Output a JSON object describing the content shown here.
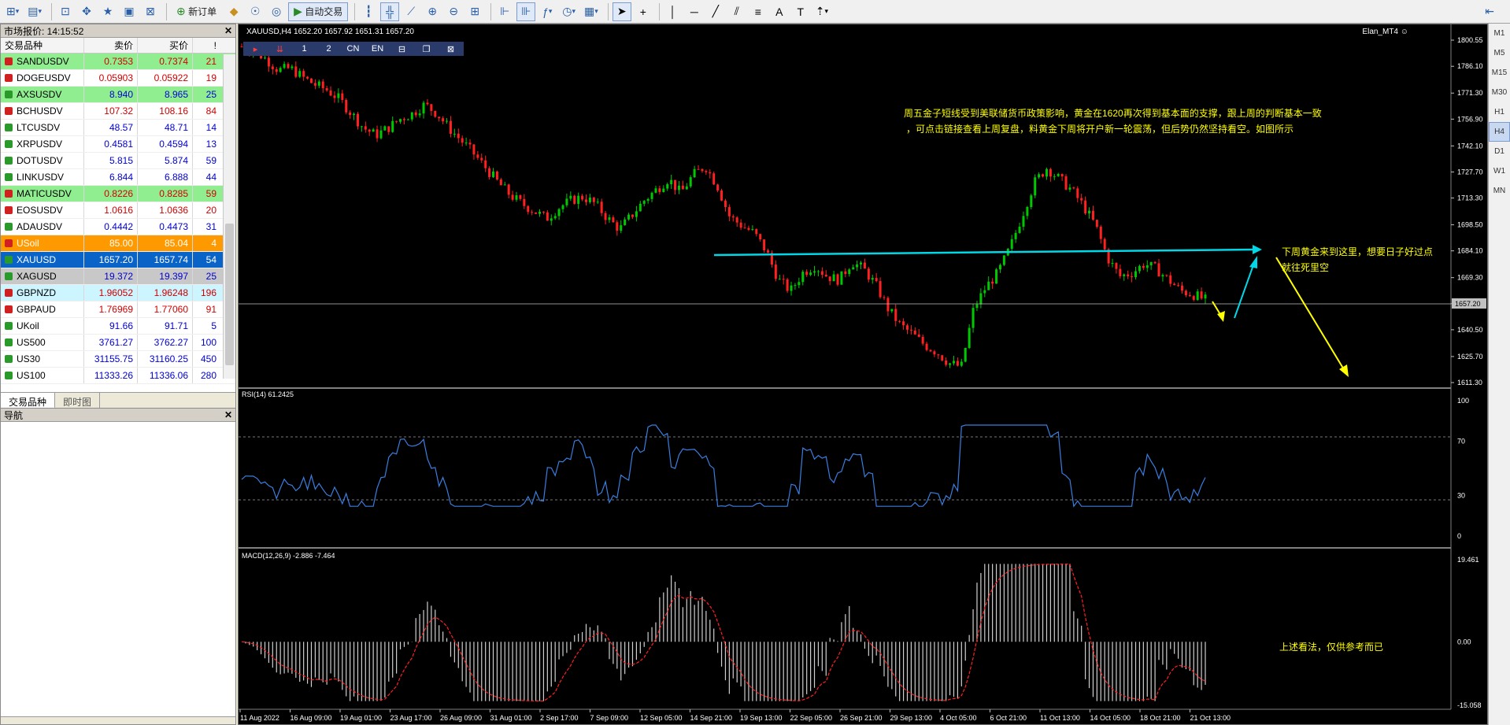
{
  "toolbar": {
    "new_order": "新订单",
    "auto_trade": "自动交易"
  },
  "market": {
    "title": "市场报价: 14:15:52",
    "headers": {
      "symbol": "交易品种",
      "bid": "卖价",
      "ask": "买价",
      "spread": "!"
    },
    "rows": [
      {
        "symbol": "SANDUSDV",
        "bid": "0.7353",
        "ask": "0.7374",
        "spread": "21",
        "bg": "#90ee90",
        "color": "#d00000",
        "dir": "down"
      },
      {
        "symbol": "DOGEUSDV",
        "bid": "0.05903",
        "ask": "0.05922",
        "spread": "19",
        "bg": "#ffffff",
        "color": "#d00000",
        "dir": "down"
      },
      {
        "symbol": "AXSUSDV",
        "bid": "8.940",
        "ask": "8.965",
        "spread": "25",
        "bg": "#90ee90",
        "color": "#0000d0",
        "dir": "up"
      },
      {
        "symbol": "BCHUSDV",
        "bid": "107.32",
        "ask": "108.16",
        "spread": "84",
        "bg": "#ffffff",
        "color": "#d00000",
        "dir": "down"
      },
      {
        "symbol": "LTCUSDV",
        "bid": "48.57",
        "ask": "48.71",
        "spread": "14",
        "bg": "#ffffff",
        "color": "#0000d0",
        "dir": "up"
      },
      {
        "symbol": "XRPUSDV",
        "bid": "0.4581",
        "ask": "0.4594",
        "spread": "13",
        "bg": "#ffffff",
        "color": "#0000d0",
        "dir": "up"
      },
      {
        "symbol": "DOTUSDV",
        "bid": "5.815",
        "ask": "5.874",
        "spread": "59",
        "bg": "#ffffff",
        "color": "#0000d0",
        "dir": "up"
      },
      {
        "symbol": "LINKUSDV",
        "bid": "6.844",
        "ask": "6.888",
        "spread": "44",
        "bg": "#ffffff",
        "color": "#0000d0",
        "dir": "up"
      },
      {
        "symbol": "MATICUSDV",
        "bid": "0.8226",
        "ask": "0.8285",
        "spread": "59",
        "bg": "#90ee90",
        "color": "#d00000",
        "dir": "down"
      },
      {
        "symbol": "EOSUSDV",
        "bid": "1.0616",
        "ask": "1.0636",
        "spread": "20",
        "bg": "#ffffff",
        "color": "#d00000",
        "dir": "down"
      },
      {
        "symbol": "ADAUSDV",
        "bid": "0.4442",
        "ask": "0.4473",
        "spread": "31",
        "bg": "#ffffff",
        "color": "#0000d0",
        "dir": "up"
      },
      {
        "symbol": "USoil",
        "bid": "85.00",
        "ask": "85.04",
        "spread": "4",
        "bg": "#ff9900",
        "color": "#ffffff",
        "dir": "down"
      },
      {
        "symbol": "XAUUSD",
        "bid": "1657.20",
        "ask": "1657.74",
        "spread": "54",
        "bg": "#0a64c8",
        "color": "#ffffff",
        "dir": "up"
      },
      {
        "symbol": "XAGUSD",
        "bid": "19.372",
        "ask": "19.397",
        "spread": "25",
        "bg": "#c8c8c8",
        "color": "#0000d0",
        "dir": "up"
      },
      {
        "symbol": "GBPNZD",
        "bid": "1.96052",
        "ask": "1.96248",
        "spread": "196",
        "bg": "#ccf5ff",
        "color": "#d00000",
        "dir": "down"
      },
      {
        "symbol": "GBPAUD",
        "bid": "1.76969",
        "ask": "1.77060",
        "spread": "91",
        "bg": "#ffffff",
        "color": "#d00000",
        "dir": "down"
      },
      {
        "symbol": "UKoil",
        "bid": "91.66",
        "ask": "91.71",
        "spread": "5",
        "bg": "#ffffff",
        "color": "#0000d0",
        "dir": "up"
      },
      {
        "symbol": "US500",
        "bid": "3761.27",
        "ask": "3762.27",
        "spread": "100",
        "bg": "#ffffff",
        "color": "#0000d0",
        "dir": "up"
      },
      {
        "symbol": "US30",
        "bid": "31155.75",
        "ask": "31160.25",
        "spread": "450",
        "bg": "#ffffff",
        "color": "#0000d0",
        "dir": "up"
      },
      {
        "symbol": "US100",
        "bid": "11333.26",
        "ask": "11336.06",
        "spread": "280",
        "bg": "#ffffff",
        "color": "#0000d0",
        "dir": "up"
      }
    ],
    "tabs": [
      "交易品种",
      "即时图"
    ]
  },
  "navigator": {
    "title": "导航"
  },
  "chart": {
    "header": "XAUUSD,H4  1652.20 1657.92 1651.31 1657.20",
    "brand": "Elan_MT4",
    "mini_buttons": [
      "1",
      "2",
      "CN",
      "EN"
    ],
    "annotation_1": "周五金子短线受到美联储货币政策影响，黄金在1620再次得到基本面的支撑，跟上周的判断基本一致",
    "annotation_2": "，可点击链接查看上周复盘，料黄金下周将开户新一轮震荡，但后势仍然坚持看空。如图所示",
    "annotation_3": "下周黄金来到这里，想要日子好过点",
    "annotation_4": "就往死里空",
    "annotation_5": "上述看法，仅供参考而已",
    "rsi_label": "RSI(14) 61.2425",
    "macd_label": "MACD(12,26,9) -2.886 -7.464",
    "price_ticks": [
      "1800.55",
      "1786.10",
      "1771.30",
      "1756.90",
      "1742.10",
      "1727.70",
      "1713.30",
      "1698.50",
      "1684.10",
      "1669.30",
      "1654.90",
      "1640.50",
      "1625.70",
      "1611.30"
    ],
    "current_price": "1657.20",
    "rsi_ticks": [
      "100",
      "70",
      "30",
      "0"
    ],
    "macd_ticks": [
      "19.461",
      "0.00",
      "-15.058"
    ],
    "time_labels": [
      "11 Aug 2022",
      "16 Aug 09:00",
      "19 Aug 01:00",
      "23 Aug 17:00",
      "26 Aug 09:00",
      "31 Aug 01:00",
      "2 Sep 17:00",
      "7 Sep 09:00",
      "12 Sep 05:00",
      "14 Sep 21:00",
      "19 Sep 13:00",
      "22 Sep 05:00",
      "26 Sep 21:00",
      "29 Sep 13:00",
      "4 Oct 05:00",
      "6 Oct 21:00",
      "11 Oct 13:00",
      "14 Oct 05:00",
      "18 Oct 21:00",
      "21 Oct 13:00"
    ]
  },
  "timeframes": [
    "M1",
    "M5",
    "M15",
    "M30",
    "H1",
    "H4",
    "D1",
    "W1",
    "MN"
  ],
  "chart_data": {
    "type": "line",
    "x": [
      0,
      1,
      2,
      3,
      4,
      5,
      6,
      7,
      8,
      9,
      10,
      11,
      12,
      13,
      14,
      15,
      16,
      17,
      18,
      19,
      20,
      21,
      22,
      23,
      24,
      25,
      26,
      27,
      28,
      29,
      30,
      31,
      32,
      33,
      34,
      35,
      36,
      37,
      38,
      39,
      40,
      41,
      42,
      43,
      44,
      45,
      46,
      47,
      48,
      49,
      50,
      51,
      52,
      53,
      54,
      55,
      56,
      57,
      58,
      59,
      60,
      61,
      62,
      63,
      64,
      65,
      66,
      67,
      68,
      69,
      70,
      71,
      72,
      73,
      74,
      75,
      76,
      77,
      78,
      79
    ],
    "series": [
      {
        "name": "XAUUSD",
        "values": [
          1797,
          1795,
          1790,
          1784,
          1785,
          1780,
          1776,
          1773,
          1768,
          1760,
          1752,
          1748,
          1752,
          1757,
          1760,
          1765,
          1760,
          1752,
          1745,
          1738,
          1730,
          1722,
          1715,
          1710,
          1706,
          1702,
          1708,
          1712,
          1714,
          1710,
          1702,
          1696,
          1704,
          1712,
          1718,
          1724,
          1716,
          1726,
          1731,
          1720,
          1703,
          1698,
          1694,
          1684,
          1668,
          1662,
          1672,
          1676,
          1670,
          1668,
          1678,
          1674,
          1665,
          1652,
          1643,
          1638,
          1632,
          1628,
          1622,
          1620,
          1652,
          1664,
          1672,
          1686,
          1704,
          1722,
          1730,
          1724,
          1718,
          1709,
          1698,
          1680,
          1670,
          1672,
          1677,
          1674,
          1668,
          1662,
          1660,
          1657
        ]
      }
    ],
    "ylim": [
      1611.3,
      1800.55
    ]
  }
}
